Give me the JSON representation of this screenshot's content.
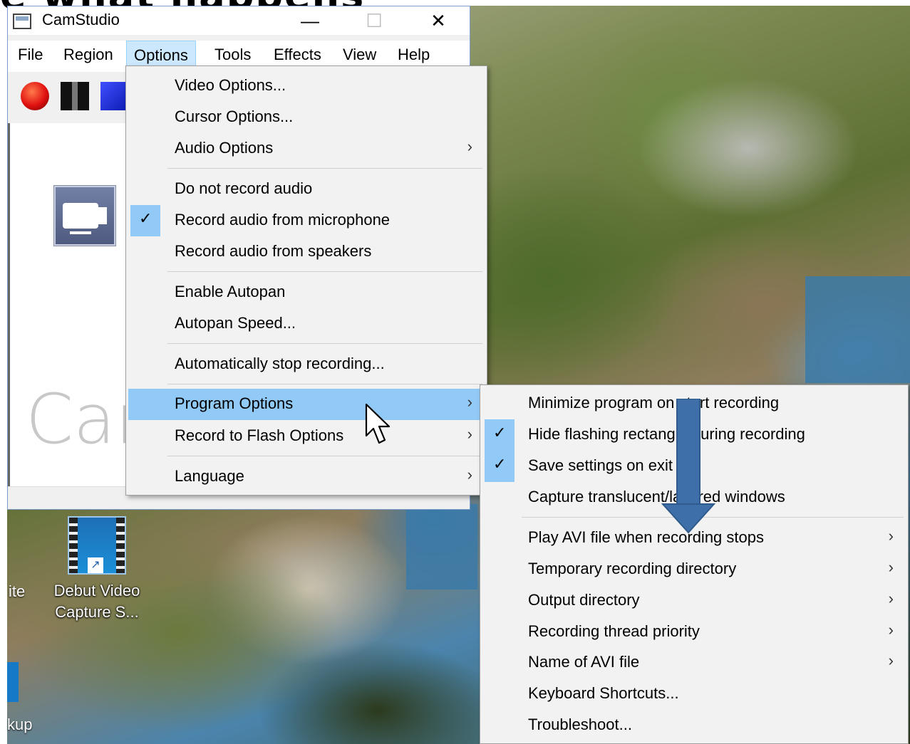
{
  "heading_fragment": "e what happens",
  "window": {
    "title": "CamStudio",
    "minimize_glyph": "—",
    "maximize_glyph": "☐",
    "close_glyph": "✕",
    "watermark": "Car",
    "menubar": [
      "File",
      "Region",
      "Options",
      "Tools",
      "Effects",
      "View",
      "Help"
    ],
    "active_menu": "Options"
  },
  "options_menu": {
    "items": [
      {
        "label": "Video Options...",
        "checked": false,
        "submenu": false
      },
      {
        "label": "Cursor Options...",
        "checked": false,
        "submenu": false
      },
      {
        "label": "Audio Options",
        "checked": false,
        "submenu": true
      },
      {
        "label": "Do not record audio",
        "checked": false,
        "submenu": false
      },
      {
        "label": "Record audio from microphone",
        "checked": true,
        "submenu": false
      },
      {
        "label": "Record audio from speakers",
        "checked": false,
        "submenu": false
      },
      {
        "label": "Enable Autopan",
        "checked": false,
        "submenu": false
      },
      {
        "label": "Autopan Speed...",
        "checked": false,
        "submenu": false
      },
      {
        "label": "Automatically stop recording...",
        "checked": false,
        "submenu": false
      },
      {
        "label": "Program Options",
        "checked": false,
        "submenu": true,
        "highlighted": true
      },
      {
        "label": "Record to Flash Options",
        "checked": false,
        "submenu": true
      },
      {
        "label": "Language",
        "checked": false,
        "submenu": true
      }
    ]
  },
  "program_options_submenu": {
    "items": [
      {
        "label": "Minimize program on start recording",
        "checked": false,
        "submenu": false
      },
      {
        "label": "Hide flashing rectangle during recording",
        "checked": true,
        "submenu": false
      },
      {
        "label": "Save settings on exit",
        "checked": true,
        "submenu": false
      },
      {
        "label": "Capture translucent/layered windows",
        "checked": false,
        "submenu": false
      },
      {
        "label": "Play AVI file when recording stops",
        "checked": false,
        "submenu": true
      },
      {
        "label": "Temporary recording directory",
        "checked": false,
        "submenu": true
      },
      {
        "label": "Output directory",
        "checked": false,
        "submenu": true
      },
      {
        "label": "Recording thread priority",
        "checked": false,
        "submenu": true
      },
      {
        "label": "Name of AVI file",
        "checked": false,
        "submenu": true
      },
      {
        "label": "Keyboard Shortcuts...",
        "checked": false,
        "submenu": false
      },
      {
        "label": "Troubleshoot...",
        "checked": false,
        "submenu": false
      }
    ]
  },
  "desktop": {
    "icon_label_line1": "Debut Video",
    "icon_label_line2": "Capture S...",
    "edge_label_left": "ite",
    "edge_label_bottom": "kup"
  },
  "glyphs": {
    "check": "✓",
    "submenu_arrow": "›",
    "shortcut_arrow": "↗"
  },
  "colors": {
    "menu_highlight": "#91c9f7",
    "active_menu_bg": "#cce8ff",
    "annotation_arrow": "#3f6fa8"
  }
}
